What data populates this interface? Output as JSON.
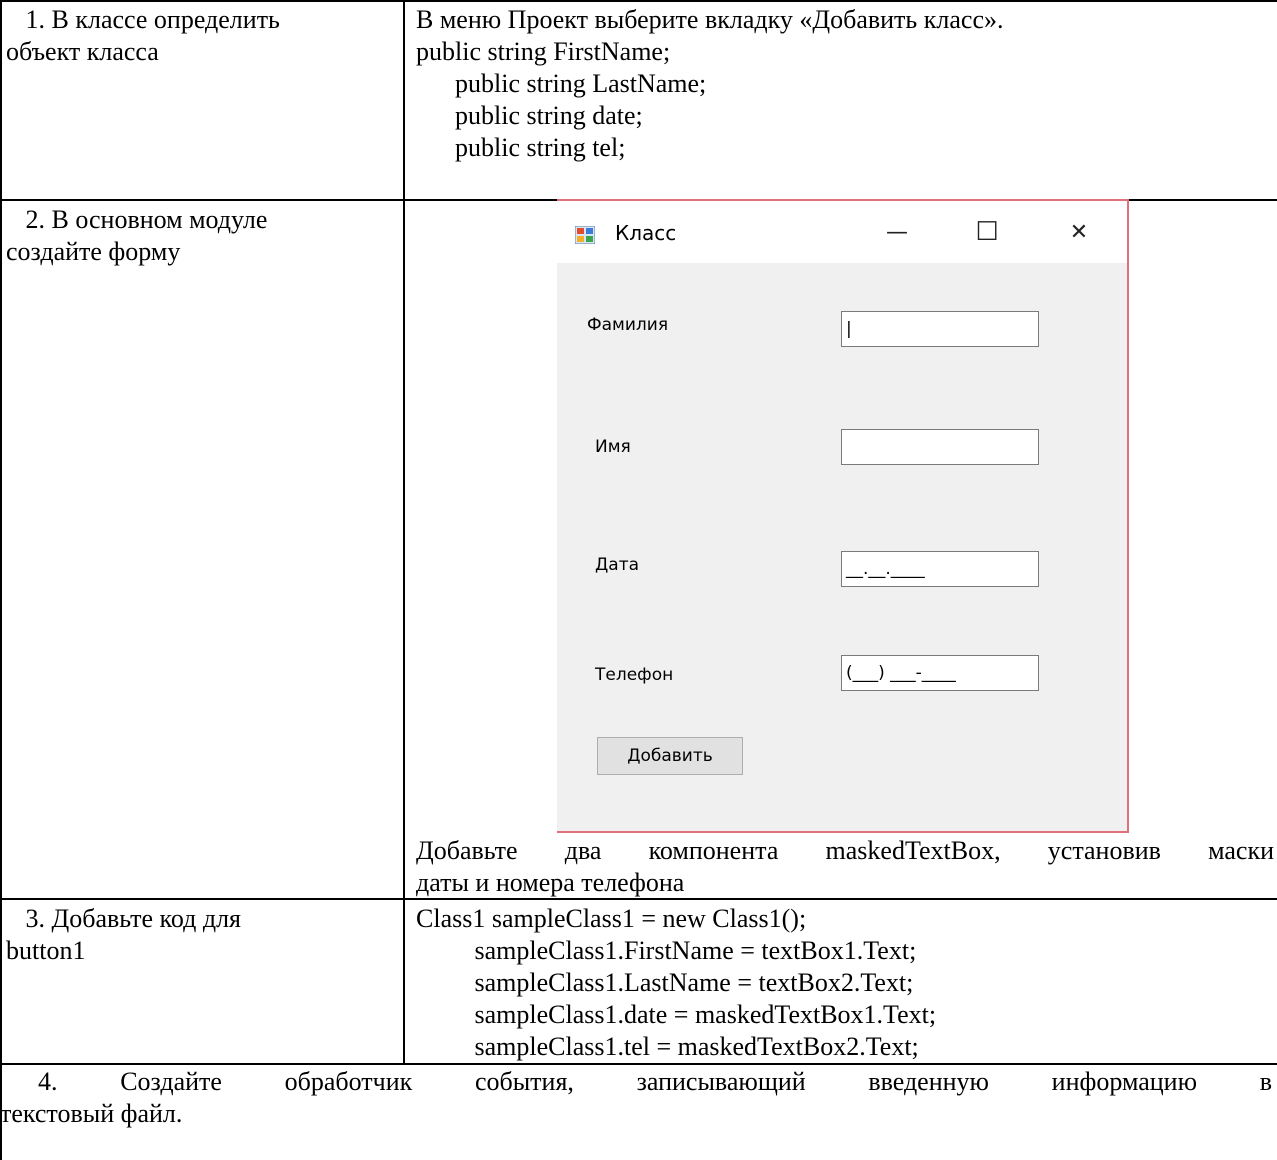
{
  "rows": [
    {
      "left_lines": [
        "   1. В классе определить",
        "объект класса"
      ],
      "right_lines": [
        "В меню Проект выберите вкладку «Добавить класс».",
        "public string FirstName;",
        "      public string LastName;",
        "      public string date;",
        "      public string tel;"
      ]
    },
    {
      "left_lines": [
        "   2. В основном модуле",
        "создайте форму"
      ],
      "right_caption_line1": "Добавьте два компонента maskedTextBox, установив маски",
      "right_caption_line2": "даты и номера телефона"
    },
    {
      "left_lines": [
        "   3. Добавьте код для",
        "button1"
      ],
      "right_lines": [
        "Class1 sampleClass1 = new Class1();",
        "         sampleClass1.FirstName = textBox1.Text;",
        "         sampleClass1.LastName = textBox2.Text;",
        "         sampleClass1.date = maskedTextBox1.Text;",
        "         sampleClass1.tel = maskedTextBox2.Text;"
      ]
    }
  ],
  "footer": {
    "line1": "4. Создайте обработчик события, записывающий введенную информацию в",
    "line2": "текстовый файл."
  },
  "form": {
    "title": "Класс",
    "minimize_glyph": "—",
    "maximize_glyph": "☐",
    "close_glyph": "✕",
    "labels": [
      "Фамилия",
      "Имя",
      "Дата",
      "Телефон"
    ],
    "fields": [
      "|",
      "",
      "__.__.____",
      "(___) ___-____"
    ],
    "button": "Добавить"
  }
}
